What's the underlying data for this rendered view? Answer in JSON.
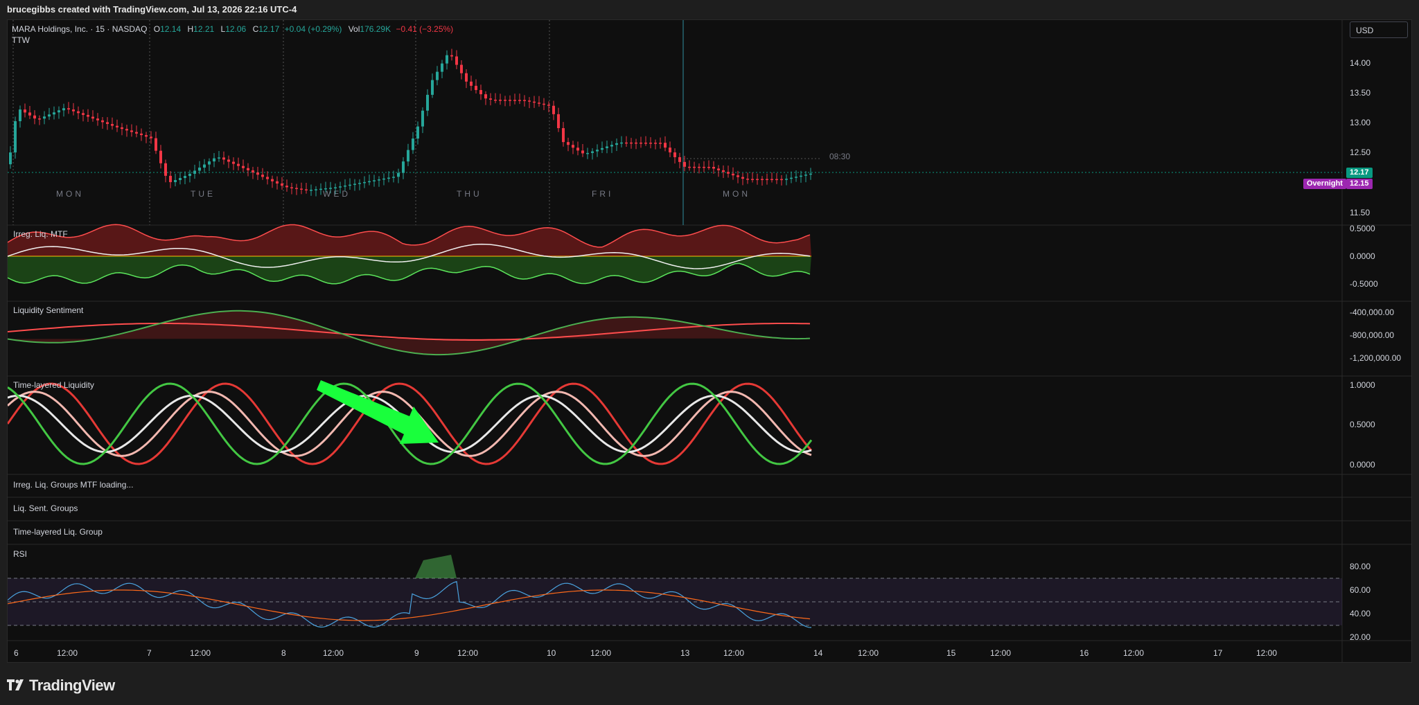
{
  "header": {
    "text": "brucegibbs created with TradingView.com, Jul 13, 2026 22:16 UTC-4"
  },
  "legend": {
    "symbol": "MARA Holdings, Inc. · 15 · NASDAQ",
    "o_key": "O",
    "o_val": "12.14",
    "h_key": "H",
    "h_val": "12.21",
    "l_key": "L",
    "l_val": "12.06",
    "c_key": "C",
    "c_val": "12.17",
    "chg": "+0.04 (+0.29%)",
    "vol_key": "Vol",
    "vol_val": "176.29K",
    "vol_chg": "−0.41 (−3.25%)",
    "ttw": "TTW"
  },
  "currency": "USD",
  "price_axis": [
    "14.00",
    "13.50",
    "13.00",
    "12.50",
    "11.50"
  ],
  "price_tags": {
    "last": "12.17",
    "overnight_label": "Overnight",
    "overnight_value": "12.15",
    "last_color": "#089981",
    "overnight_color": "#9c27b0"
  },
  "session_time": "08:30",
  "days": [
    "MON",
    "TUE",
    "WED",
    "THU",
    "FRI",
    "MON"
  ],
  "panes": {
    "irreg": {
      "label": "Irreg. Liq. MTF",
      "axis": [
        "0.5000",
        "0.0000",
        "-0.5000"
      ]
    },
    "sentiment": {
      "label": "Liquidity Sentiment",
      "axis": [
        "-400,000.00",
        "-800,000.00",
        "-1,200,000.00"
      ]
    },
    "timelayered": {
      "label": "Time-layered Liquidity",
      "axis": [
        "1.0000",
        "0.5000",
        "0.0000"
      ]
    },
    "groups_mtf": {
      "label": "Irreg. Liq. Groups MTF loading..."
    },
    "sent_groups": {
      "label": "Liq. Sent. Groups"
    },
    "time_group": {
      "label": "Time-layered Liq. Group"
    },
    "rsi": {
      "label": "RSI",
      "axis": [
        "80.00",
        "60.00",
        "40.00",
        "20.00"
      ]
    }
  },
  "time_axis": [
    "6",
    "12:00",
    "7",
    "12:00",
    "8",
    "12:00",
    "9",
    "12:00",
    "10",
    "12:00",
    "13",
    "12:00",
    "14",
    "12:00",
    "15",
    "12:00",
    "16",
    "12:00",
    "17",
    "12:00"
  ],
  "colors": {
    "up": "#26a69a",
    "down": "#f23645",
    "arrow": "#19ff3c"
  },
  "footer": {
    "brand": "TradingView",
    "logo_icon": "tradingview-logo-icon"
  }
}
